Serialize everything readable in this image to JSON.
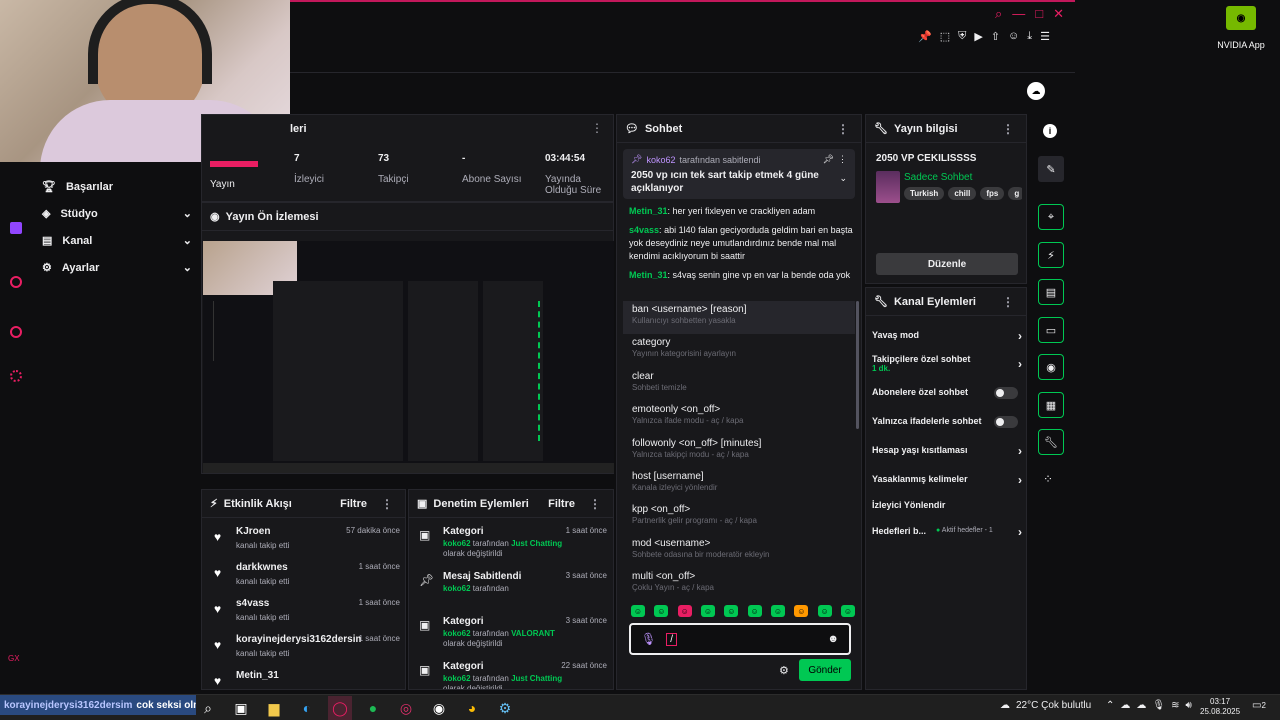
{
  "webcam": {
    "label": ""
  },
  "sidebar_nav": [
    {
      "label": "Başarılar",
      "icon": "trophy-icon"
    },
    {
      "label": "Stüdyo",
      "icon": "studio-icon"
    },
    {
      "label": "Kanal",
      "icon": "channel-icon"
    },
    {
      "label": "Ayarlar",
      "icon": "settings-icon"
    }
  ],
  "stats": {
    "partial_header": "leri",
    "items": [
      {
        "value": "",
        "label": "Yayın"
      },
      {
        "value": "7",
        "label": "İzleyici"
      },
      {
        "value": "73",
        "label": "Takipçi"
      },
      {
        "value": "-",
        "label": "Abone Sayısı"
      },
      {
        "value": "03:44:54",
        "label": "Yayında Olduğu Süre"
      }
    ]
  },
  "preview": {
    "title": "Yayın Ön İzlemesi"
  },
  "activity": {
    "title": "Etkinlik Akışı",
    "filter": "Filtre",
    "items": [
      {
        "name": "KJroen",
        "time": "57 dakika önce",
        "desc": "kanalı takip etti"
      },
      {
        "name": "darkkwnes",
        "time": "1 saat önce",
        "desc": "kanalı takip etti"
      },
      {
        "name": "s4vass",
        "time": "1 saat önce",
        "desc": "kanalı takip etti"
      },
      {
        "name": "korayinejderysi3162dersim",
        "time": "1 saat önce",
        "desc": "kanalı takip etti"
      },
      {
        "name": "Metin_31",
        "time": "",
        "desc": ""
      }
    ]
  },
  "mod": {
    "title": "Denetim Eylemleri",
    "filter": "Filtre",
    "items": [
      {
        "title": "Kategori",
        "time": "1 saat önce",
        "user": "koko62",
        "mid": " tarafından ",
        "hl": "Just Chatting",
        "rest": " olarak değiştirildi"
      },
      {
        "title": "Mesaj Sabitlendi",
        "time": "3 saat önce",
        "user": "koko62",
        "mid": " tarafından",
        "hl": "",
        "rest": ""
      },
      {
        "title": "Kategori",
        "time": "3 saat önce",
        "user": "koko62",
        "mid": " tarafından ",
        "hl": "VALORANT",
        "rest": " olarak değiştirildi"
      },
      {
        "title": "Kategori",
        "time": "22 saat önce",
        "user": "koko62",
        "mid": " tarafından ",
        "hl": "Just Chatting",
        "rest": " olarak değiştirildi"
      }
    ]
  },
  "chat": {
    "title": "Sohbet",
    "pinned_by": "koko62",
    "pinned_suffix": "tarafından sabitlendi",
    "pinned_text": "2050 vp ıcın tek sart takip etmek 4 güne açıklanıyor",
    "messages": [
      {
        "user": "Metin_31",
        "text": "her yeri fixleyen ve crackliyen adam"
      },
      {
        "user": "s4vass",
        "text": "abi 1l40 falan geciyorduda geldim bari en başta yok deseydiniz neye umutlandırdınız bende mal mal kendimi acıklıyorum bi saattir"
      },
      {
        "user": "Metin_31",
        "text": "s4vaş senin gine vp en var la bende oda yok"
      }
    ],
    "commands": [
      {
        "cmd": "ban <username> [reason]",
        "desc": "Kullanıcıyı sohbetten yasakla"
      },
      {
        "cmd": "category",
        "desc": "Yayının kategorisini ayarlayın"
      },
      {
        "cmd": "clear",
        "desc": "Sohbeti temizle"
      },
      {
        "cmd": "emoteonly <on_off>",
        "desc": "Yalnızca ifade modu - aç / kapa"
      },
      {
        "cmd": "followonly <on_off> [minutes]",
        "desc": "Yalnızca takipçi modu - aç / kapa"
      },
      {
        "cmd": "host [username]",
        "desc": "Kanala izleyici yönlendir"
      },
      {
        "cmd": "kpp <on_off>",
        "desc": "Partnerlik gelir programı - aç / kapa"
      },
      {
        "cmd": "mod <username>",
        "desc": "Sohbete odasına bir moderatör ekleyin"
      },
      {
        "cmd": "multi <on_off>",
        "desc": "Çoklu Yayın - aç / kapa"
      }
    ],
    "input_value": "/",
    "send": "Gönder"
  },
  "stream_info": {
    "title": "Yayın bilgisi",
    "stream_title": "2050 VP CEKILISSSS",
    "category": "Sadece Sohbet",
    "tags": [
      "Turkish",
      "chill",
      "fps",
      "g"
    ],
    "edit": "Düzenle"
  },
  "channel_actions": {
    "title": "Kanal Eylemleri",
    "items": [
      {
        "label": "Yavaş mod",
        "sub": "",
        "control": "chevron"
      },
      {
        "label": "Takipçilere özel sohbet",
        "sub": "1 dk.",
        "control": "chevron"
      },
      {
        "label": "Abonelere özel sohbet",
        "sub": "",
        "control": "toggle"
      },
      {
        "label": "Yalnızca ifadelerle sohbet",
        "sub": "",
        "control": "toggle"
      },
      {
        "label": "Hesap yaşı kısıtlaması",
        "sub": "",
        "control": "chevron"
      },
      {
        "label": "Yasaklanmış kelimeler",
        "sub": "",
        "control": "chevron"
      },
      {
        "label": "İzleyici Yönlendir",
        "sub": "",
        "control": "none"
      },
      {
        "label": "Hedefleri b...",
        "sub": "",
        "control": "goals"
      }
    ],
    "goals_text": "Aktif hedefler - 1"
  },
  "nvidia": {
    "label": "NVIDIA App"
  },
  "overlay_chat": {
    "user": "korayinejderysi3162dersim",
    "text": "cok seksi olmus"
  },
  "taskbar": {
    "weather": "22°C  Çok bulutlu",
    "time": "03:17",
    "date": "25.08.2025",
    "notif": "2"
  },
  "colors": {
    "accent": "#00c853",
    "twitch_purple": "#9146ff",
    "brand_red": "#e91e63",
    "bg": "#0e0e10"
  }
}
